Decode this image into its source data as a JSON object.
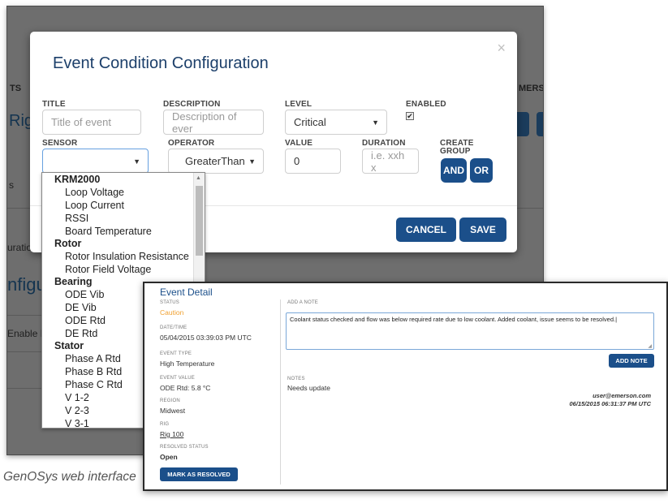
{
  "background": {
    "header_left": "TS",
    "header_right": "MERS",
    "rig": "Rig",
    "s": "s",
    "uration": "uratio",
    "configu": "nfigu",
    "enable": "Enable D"
  },
  "modal": {
    "title": "Event Condition Configuration",
    "close": "×",
    "fields": {
      "title_label": "TITLE",
      "title_placeholder": "Title of event",
      "description_label": "DESCRIPTION",
      "description_placeholder": "Description of ever",
      "level_label": "LEVEL",
      "level_value": "Critical",
      "enabled_label": "ENABLED",
      "enabled_checked": "✔",
      "sensor_label": "SENSOR",
      "sensor_value": "",
      "operator_label": "OPERATOR",
      "operator_value": "GreaterThan",
      "value_label": "VALUE",
      "value_value": "0",
      "duration_label": "DURATION",
      "duration_placeholder": "i.e. xxh x",
      "create_group_label_1": "CREATE",
      "create_group_label_2": "GROUP",
      "and_label": "AND",
      "or_label": "OR"
    },
    "cancel_label": "CANCEL",
    "save_label": "SAVE"
  },
  "sensor_dropdown": {
    "groups": [
      {
        "name": "KRM2000",
        "items": [
          "Loop Voltage",
          "Loop Current",
          "RSSI",
          "Board Temperature"
        ]
      },
      {
        "name": "Rotor",
        "items": [
          "Rotor Insulation Resistance",
          "Rotor Field Voltage"
        ]
      },
      {
        "name": "Bearing",
        "items": [
          "ODE Vib",
          "DE Vib",
          "ODE Rtd",
          "DE Rtd"
        ]
      },
      {
        "name": "Stator",
        "items": [
          "Phase A Rtd",
          "Phase B Rtd",
          "Phase C Rtd",
          "V 1-2",
          "V 2-3",
          "V 3-1"
        ]
      }
    ]
  },
  "event_detail": {
    "title": "Event Detail",
    "status_label": "STATUS",
    "status_value": "Caution",
    "status_color": "#f0a030",
    "datetime_label": "DATE/TIME",
    "datetime_value": "05/04/2015 03:39:03 PM UTC",
    "event_type_label": "EVENT TYPE",
    "event_type_value": "High Temperature",
    "event_value_label": "EVENT VALUE",
    "event_value_value": "ODE Rtd: 5.8 °C",
    "region_label": "REGION",
    "region_value": "Midwest",
    "rig_label": "RIG",
    "rig_value": "Rig 100",
    "resolved_label": "RESOLVED STATUS",
    "resolved_value": "Open",
    "mark_resolved_label": "MARK AS RESOLVED",
    "add_note_label": "ADD A NOTE",
    "note_text": "Coolant status checked and flow was below required rate due to low coolant.  Added coolant, issue seems to be resolved.|",
    "add_note_button": "ADD NOTE",
    "notes_label": "NOTES",
    "note_entry": "Needs update",
    "note_user": "user@emerson.com",
    "note_time": "06/15/2015 06:31:37 PM UTC"
  },
  "caption": "GenOSys web interface"
}
